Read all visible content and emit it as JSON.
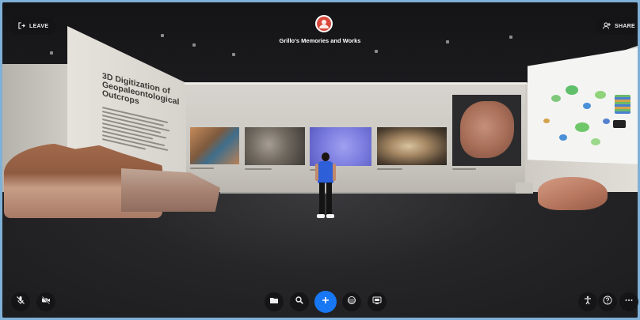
{
  "header": {
    "title": "Grillo's Memories and Works",
    "leave_label": "LEAVE",
    "share_label": "SHARE"
  },
  "exhibit": {
    "wall_title": "3D Digitization of Geopaleontological Outcrops"
  },
  "toolbar": {
    "left": [
      {
        "name": "mic-muted-button",
        "icon": "mic-off-icon"
      },
      {
        "name": "camera-off-button",
        "icon": "video-off-icon"
      }
    ],
    "center": [
      {
        "name": "files-button",
        "icon": "folder-icon"
      },
      {
        "name": "search-button",
        "icon": "search-icon"
      },
      {
        "name": "add-button",
        "icon": "plus-icon"
      },
      {
        "name": "reactions-button",
        "icon": "emoji-icon"
      },
      {
        "name": "screen-share-button",
        "icon": "screen-icon"
      }
    ],
    "right": [
      {
        "name": "accessibility-button",
        "icon": "accessibility-icon"
      },
      {
        "name": "help-button",
        "icon": "help-icon"
      },
      {
        "name": "more-button",
        "icon": "more-icon"
      }
    ]
  },
  "colors": {
    "accent": "#1877f2",
    "badge": "#d94a3c",
    "frame": "#7fb0d6"
  }
}
